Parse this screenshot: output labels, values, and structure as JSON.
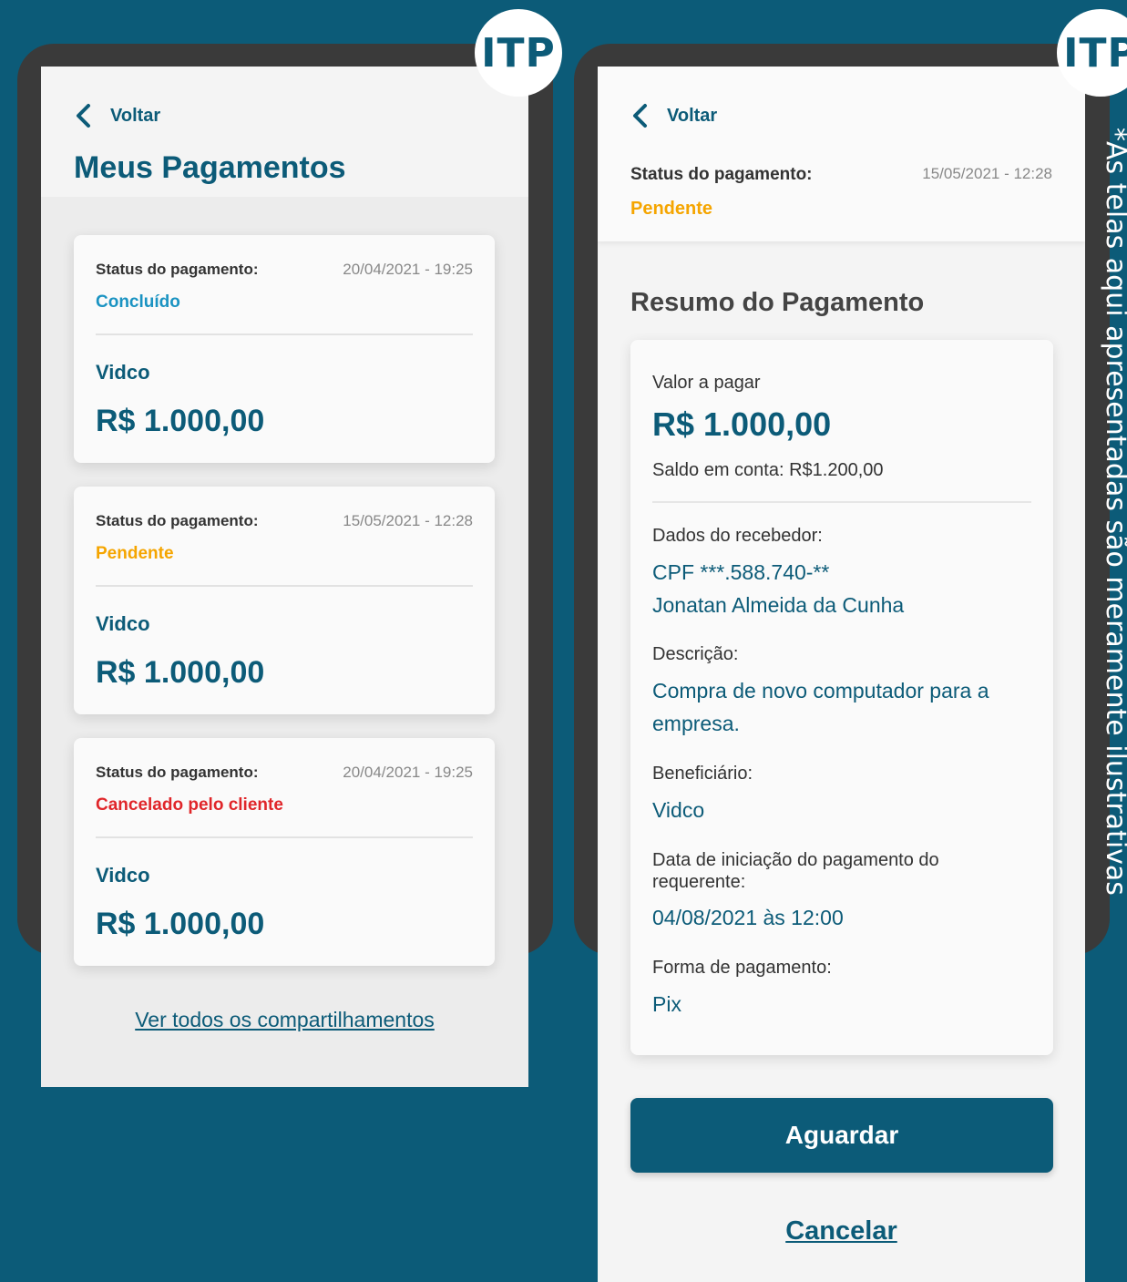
{
  "badge_text": "ITP",
  "side_note": "*As telas aqui apresentadas são meramente ilustrativas",
  "left_screen": {
    "back_label": "Voltar",
    "title": "Meus Pagamentos",
    "payments": [
      {
        "status_label": "Status do pagamento:",
        "date": "20/04/2021 - 19:25",
        "status": "Concluído",
        "status_color": "#1a93c2",
        "merchant": "Vidco",
        "amount": "R$ 1.000,00"
      },
      {
        "status_label": "Status do pagamento:",
        "date": "15/05/2021 - 12:28",
        "status": "Pendente",
        "status_color": "#f5a500",
        "merchant": "Vidco",
        "amount": "R$ 1.000,00"
      },
      {
        "status_label": "Status do pagamento:",
        "date": "20/04/2021 - 19:25",
        "status": "Cancelado pelo cliente",
        "status_color": "#e0262a",
        "merchant": "Vidco",
        "amount": "R$ 1.000,00"
      }
    ],
    "view_all_link": "Ver todos os compartilhamentos"
  },
  "right_screen": {
    "back_label": "Voltar",
    "status_label": "Status do pagamento:",
    "date": "15/05/2021 - 12:28",
    "status": "Pendente",
    "status_color": "#f5a500",
    "summary_title": "Resumo do Pagamento",
    "summary": {
      "amount_label": "Valor a pagar",
      "amount": "R$ 1.000,00",
      "balance": "Saldo em conta: R$1.200,00",
      "recipient_label": "Dados do recebedor:",
      "recipient_cpf": "CPF ***.588.740-**",
      "recipient_name": "Jonatan Almeida da Cunha",
      "description_label": "Descrição:",
      "description_line1": "Compra de novo computador para a",
      "description_line2": "empresa.",
      "beneficiary_label": "Beneficiário:",
      "beneficiary": "Vidco",
      "initiation_label_line1": "Data de iniciação do pagamento do",
      "initiation_label_line2": "requerente:",
      "initiation_date": "04/08/2021 às 12:00",
      "payment_method_label": "Forma de pagamento:",
      "payment_method": "Pix"
    },
    "primary_button": "Aguardar",
    "secondary_button": "Cancelar"
  }
}
